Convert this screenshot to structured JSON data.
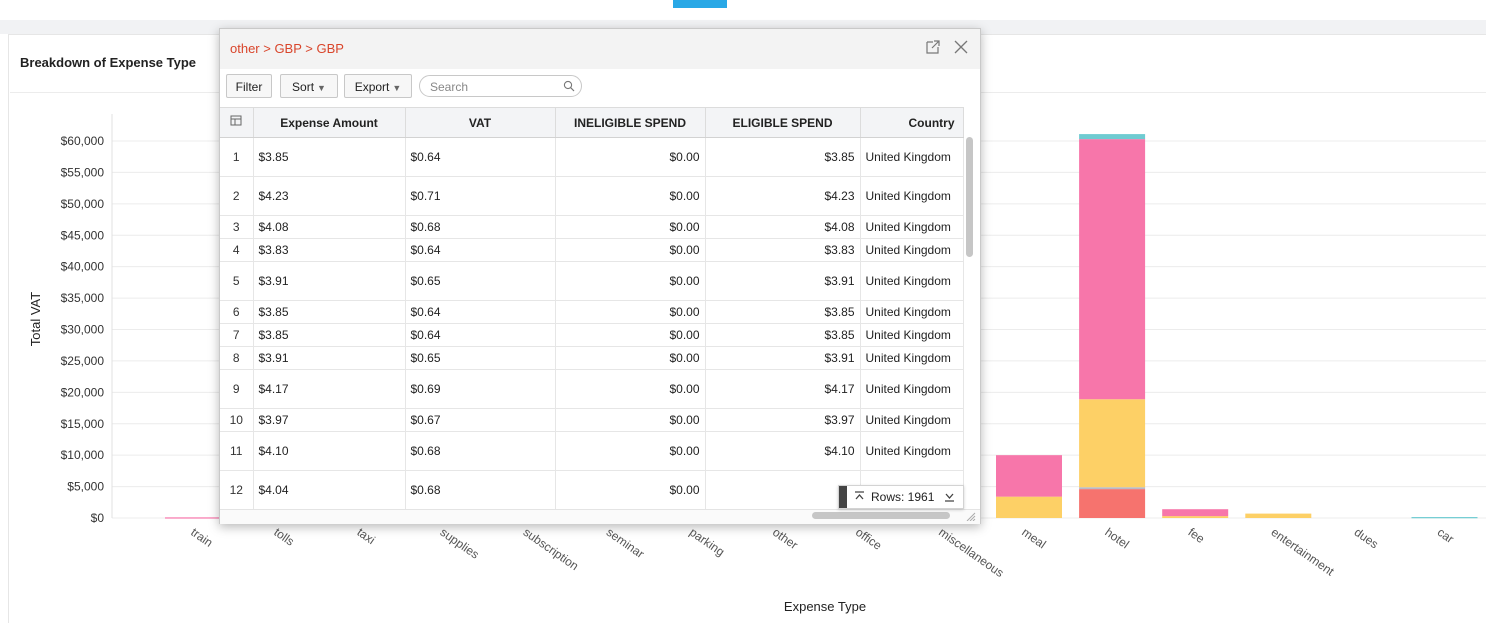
{
  "panel": {
    "title": "Breakdown of Expense Type"
  },
  "chart_data": {
    "type": "bar",
    "stacked": true,
    "xlabel": "Expense Type",
    "ylabel": "Total VAT",
    "ylim": [
      0,
      60000
    ],
    "y_ticks": [
      "$0",
      "$5,000",
      "$10,000",
      "$15,000",
      "$20,000",
      "$25,000",
      "$30,000",
      "$35,000",
      "$40,000",
      "$45,000",
      "$50,000",
      "$55,000",
      "$60,000"
    ],
    "categories": [
      "train",
      "tolls",
      "taxi",
      "supplies",
      "subscription",
      "seminar",
      "parking",
      "other",
      "office",
      "miscellaneous",
      "meal",
      "hotel",
      "fee",
      "entertainment",
      "dues",
      "car"
    ],
    "series": [
      {
        "color": "#f6736e",
        "values": [
          0,
          0,
          0,
          0,
          0,
          0,
          0,
          0,
          0,
          0,
          0,
          4600,
          0,
          0,
          0,
          0
        ]
      },
      {
        "color": "#b9b9c6",
        "values": [
          0,
          0,
          0,
          0,
          0,
          0,
          0,
          0,
          0,
          0,
          0,
          300,
          0,
          0,
          0,
          0
        ]
      },
      {
        "color": "#fdd066",
        "values": [
          0,
          0,
          0,
          0,
          0,
          0,
          0,
          0,
          0,
          0,
          3400,
          14000,
          300,
          700,
          0,
          0
        ]
      },
      {
        "color": "#f776aa",
        "values": [
          100,
          0,
          0,
          0,
          0,
          0,
          0,
          0,
          0,
          0,
          6600,
          41400,
          1100,
          0,
          0,
          0
        ]
      },
      {
        "color": "#6fcbd1",
        "values": [
          0,
          0,
          0,
          0,
          0,
          0,
          0,
          0,
          0,
          0,
          0,
          800,
          0,
          0,
          0,
          150
        ]
      }
    ],
    "grid": true
  },
  "popup": {
    "breadcrumb": "other > GBP > GBP",
    "toolbar": {
      "filter_label": "Filter",
      "sort_label": "Sort",
      "export_label": "Export",
      "search_placeholder": "Search"
    },
    "columns": [
      "Expense Amount",
      "VAT",
      "INELIGIBLE SPEND",
      "ELIGIBLE SPEND",
      "Country"
    ],
    "rows": [
      {
        "n": "1",
        "amount": "$3.85",
        "vat": "$0.64",
        "ineligible": "$0.00",
        "eligible": "$3.85",
        "country": "United Kingdom"
      },
      {
        "n": "2",
        "amount": "$4.23",
        "vat": "$0.71",
        "ineligible": "$0.00",
        "eligible": "$4.23",
        "country": "United Kingdom"
      },
      {
        "n": "3",
        "amount": "$4.08",
        "vat": "$0.68",
        "ineligible": "$0.00",
        "eligible": "$4.08",
        "country": "United Kingdom"
      },
      {
        "n": "4",
        "amount": "$3.83",
        "vat": "$0.64",
        "ineligible": "$0.00",
        "eligible": "$3.83",
        "country": "United Kingdom"
      },
      {
        "n": "5",
        "amount": "$3.91",
        "vat": "$0.65",
        "ineligible": "$0.00",
        "eligible": "$3.91",
        "country": "United Kingdom"
      },
      {
        "n": "6",
        "amount": "$3.85",
        "vat": "$0.64",
        "ineligible": "$0.00",
        "eligible": "$3.85",
        "country": "United Kingdom"
      },
      {
        "n": "7",
        "amount": "$3.85",
        "vat": "$0.64",
        "ineligible": "$0.00",
        "eligible": "$3.85",
        "country": "United Kingdom"
      },
      {
        "n": "8",
        "amount": "$3.91",
        "vat": "$0.65",
        "ineligible": "$0.00",
        "eligible": "$3.91",
        "country": "United Kingdom"
      },
      {
        "n": "9",
        "amount": "$4.17",
        "vat": "$0.69",
        "ineligible": "$0.00",
        "eligible": "$4.17",
        "country": "United Kingdom"
      },
      {
        "n": "10",
        "amount": "$3.97",
        "vat": "$0.67",
        "ineligible": "$0.00",
        "eligible": "$3.97",
        "country": "United Kingdom"
      },
      {
        "n": "11",
        "amount": "$4.10",
        "vat": "$0.68",
        "ineligible": "$0.00",
        "eligible": "$4.10",
        "country": "United Kingdom"
      },
      {
        "n": "12",
        "amount": "$4.04",
        "vat": "$0.68",
        "ineligible": "$0.00",
        "eligible": "$4.",
        "country": ""
      }
    ],
    "rows_count_label": "Rows: 1961",
    "icons": [
      "popout-icon",
      "close-icon",
      "search-icon",
      "column-chooser-icon",
      "scroll-top-icon",
      "scroll-bottom-icon",
      "resize-grip-icon"
    ]
  }
}
